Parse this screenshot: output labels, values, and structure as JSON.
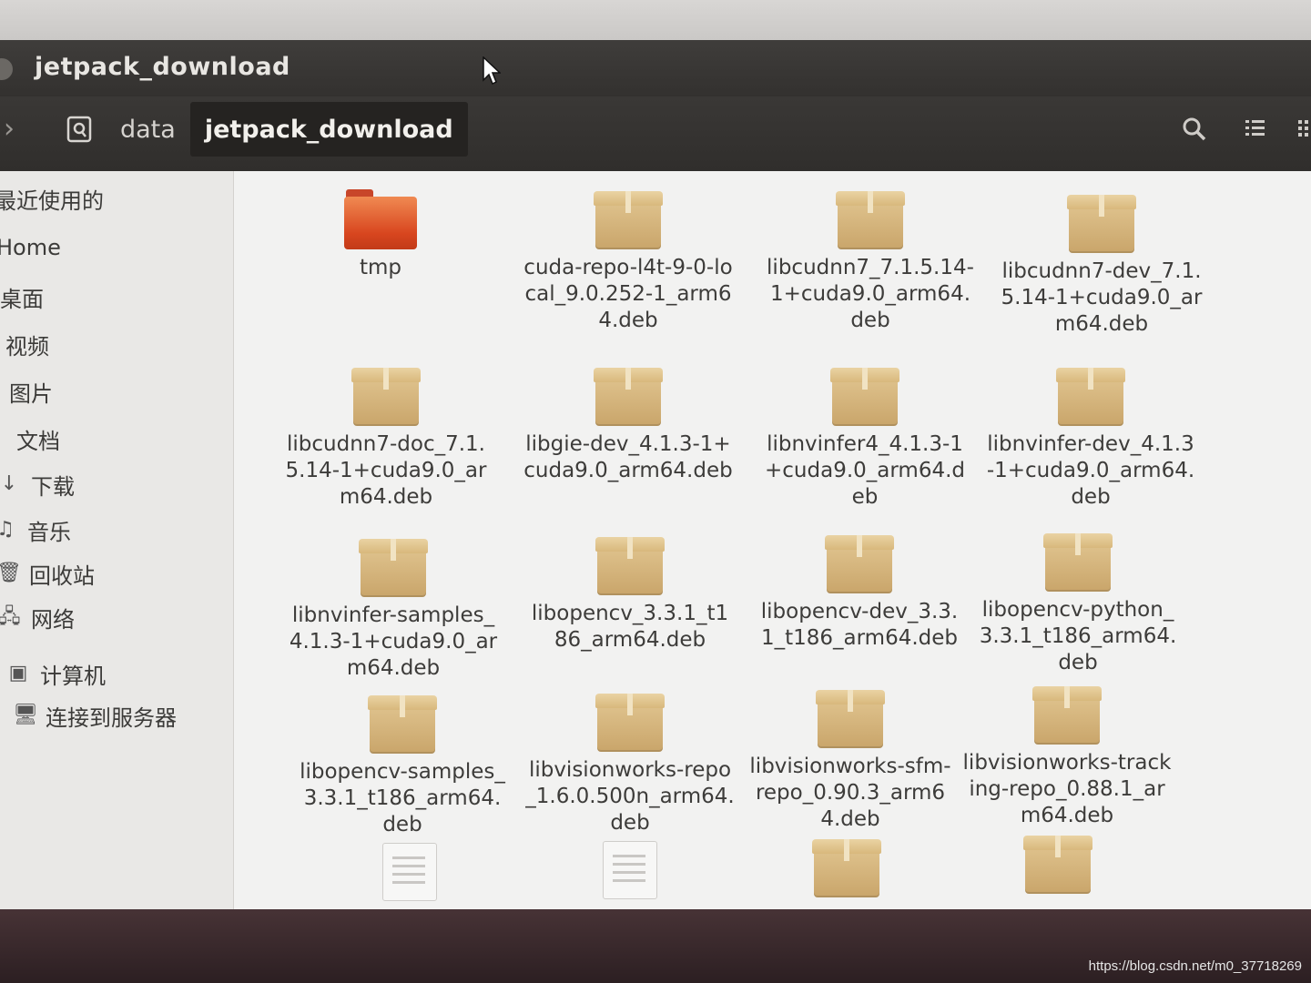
{
  "window": {
    "title": "jetpack_download"
  },
  "toolbar": {
    "breadcrumbs": [
      "data",
      "jetpack_download"
    ]
  },
  "sidebar": {
    "items": [
      "最近使用的",
      "Home",
      "桌面",
      "视频",
      "图片",
      "文档",
      "下载",
      "音乐",
      "回收站",
      "网络",
      "计算机",
      "连接到服务器"
    ]
  },
  "files": [
    {
      "name": "tmp",
      "icon": "folder-icon"
    },
    {
      "name": "cuda-repo-l4t-9-0-local_9.0.252-1_arm64.deb",
      "icon": "package-icon"
    },
    {
      "name": "libcudnn7_7.1.5.14-1+cuda9.0_arm64.deb",
      "icon": "package-icon"
    },
    {
      "name": "libcudnn7-dev_7.1.5.14-1+cuda9.0_arm64.deb",
      "icon": "package-icon"
    },
    {
      "name": "libcudnn7-doc_7.1.5.14-1+cuda9.0_arm64.deb",
      "icon": "package-icon"
    },
    {
      "name": "libgie-dev_4.1.3-1+cuda9.0_arm64.deb",
      "icon": "package-icon"
    },
    {
      "name": "libnvinfer4_4.1.3-1+cuda9.0_arm64.deb",
      "icon": "package-icon"
    },
    {
      "name": "libnvinfer-dev_4.1.3-1+cuda9.0_arm64.deb",
      "icon": "package-icon"
    },
    {
      "name": "libnvinfer-samples_4.1.3-1+cuda9.0_arm64.deb",
      "icon": "package-icon"
    },
    {
      "name": "libopencv_3.3.1_t186_arm64.deb",
      "icon": "package-icon"
    },
    {
      "name": "libopencv-dev_3.3.1_t186_arm64.deb",
      "icon": "package-icon"
    },
    {
      "name": "libopencv-python_3.3.1_t186_arm64.deb",
      "icon": "package-icon"
    },
    {
      "name": "libopencv-samples_3.3.1_t186_arm64.deb",
      "icon": "package-icon"
    },
    {
      "name": "libvisionworks-repo_1.6.0.500n_arm64.deb",
      "icon": "package-icon"
    },
    {
      "name": "libvisionworks-sfm-repo_0.90.3_arm64.deb",
      "icon": "package-icon"
    },
    {
      "name": "libvisionworks-tracking-repo_0.88.1_arm64.deb",
      "icon": "package-icon"
    }
  ],
  "watermark": "https://blog.csdn.net/m0_37718269"
}
